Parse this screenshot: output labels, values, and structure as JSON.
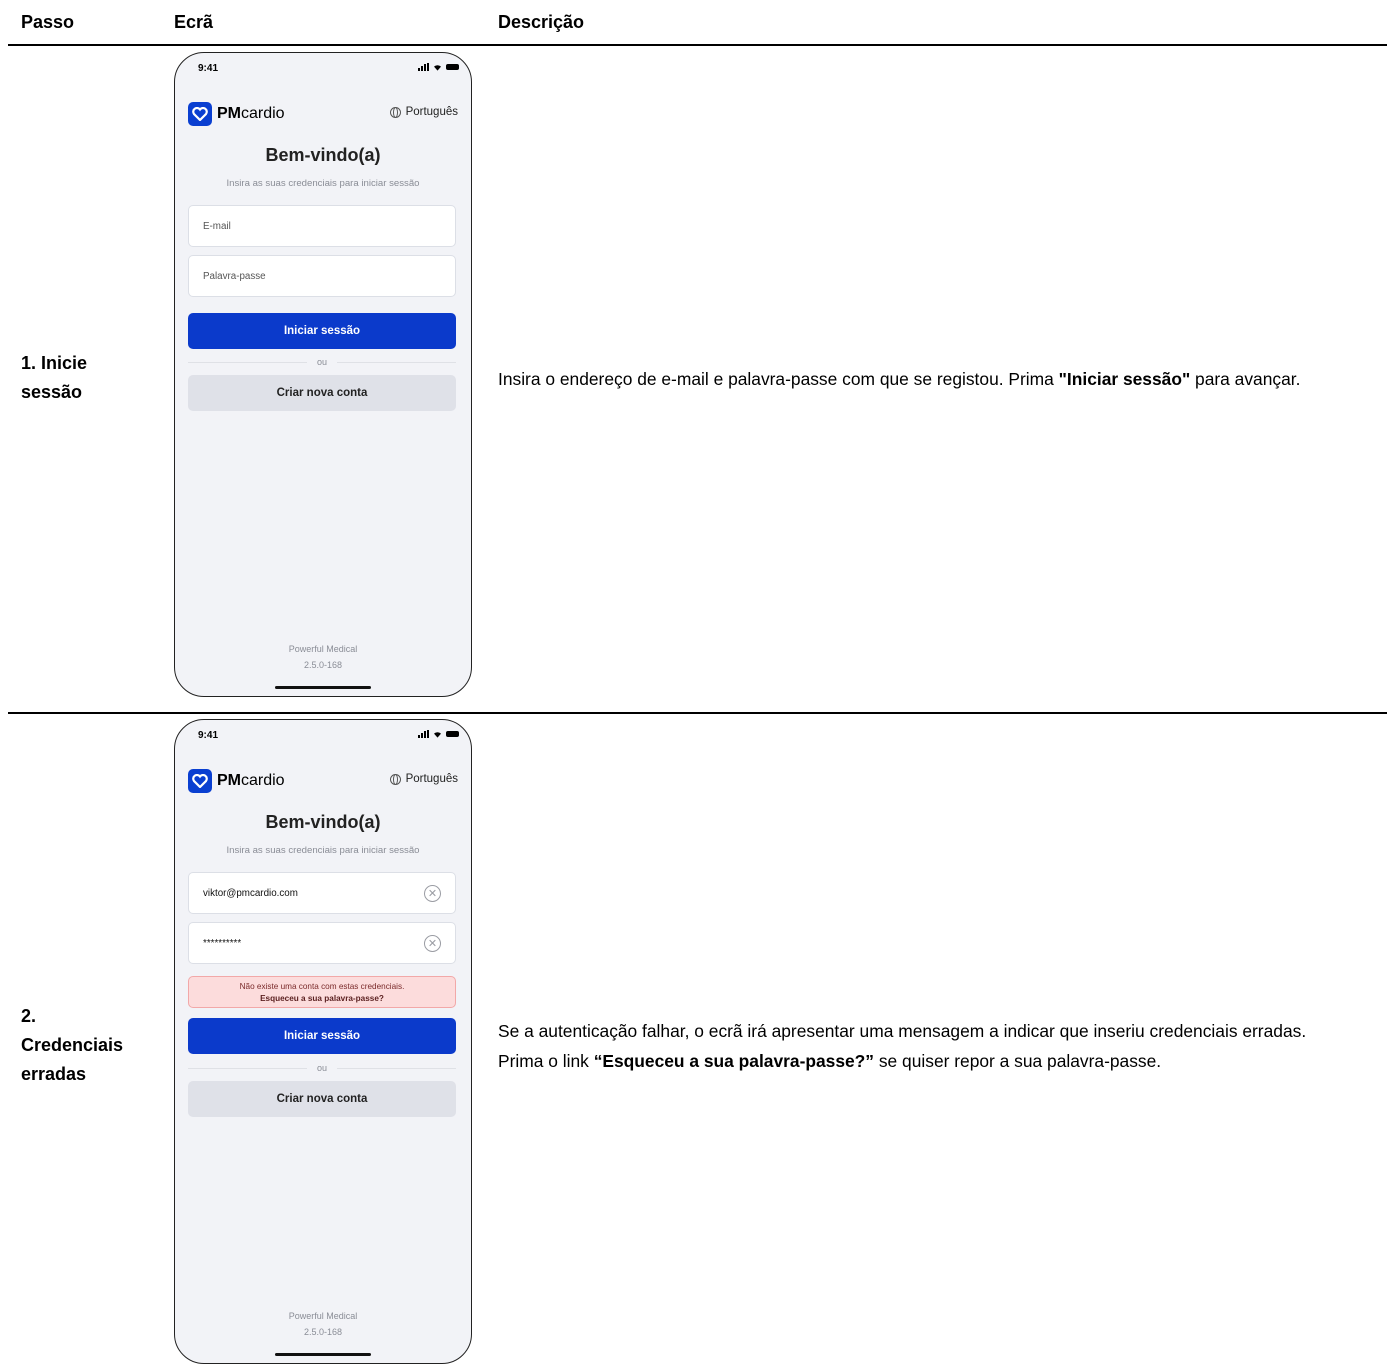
{
  "table": {
    "headers": {
      "step": "Passo",
      "screen": "Ecrã",
      "description": "Descrição"
    }
  },
  "rows": [
    {
      "step_lines": [
        "1. Inicie",
        "sessão"
      ],
      "description": {
        "pre": "Insira o endereço de e-mail e palavra-passe com que se registou. Prima ",
        "bold": "\"Iniciar sessão\"",
        "post": " para avançar."
      },
      "phone": {
        "time": "9:41",
        "brand_bold": "PM",
        "brand_rest": "cardio",
        "language": "Português",
        "title": "Bem-vindo(a)",
        "subtitle": "Insira as suas credenciais para iniciar sessão",
        "email_placeholder": "E-mail",
        "password_placeholder": "Palavra-passe",
        "login_button": "Iniciar sessão",
        "divider": "ou",
        "create_account_button": "Criar nova conta",
        "footer_brand": "Powerful Medical",
        "footer_version": "2.5.0-168"
      }
    },
    {
      "step_lines": [
        "2.",
        "Credenciais",
        "erradas"
      ],
      "description": {
        "line1": "Se a autenticação falhar, o ecrã irá apresentar uma mensagem a indicar que inseriu credenciais erradas.",
        "pre": "Prima o link ",
        "bold": "“Esqueceu a sua palavra-passe?”",
        "post": " se quiser repor a sua palavra-passe."
      },
      "phone": {
        "time": "9:41",
        "brand_bold": "PM",
        "brand_rest": "cardio",
        "language": "Português",
        "title": "Bem-vindo(a)",
        "subtitle": "Insira as suas credenciais para iniciar sessão",
        "email_value": "viktor@pmcardio.com",
        "password_value": "**********",
        "error_message": "Não existe uma conta com estas credenciais.",
        "error_link": "Esqueceu a sua palavra-passe?",
        "login_button": "Iniciar sessão",
        "divider": "ou",
        "create_account_button": "Criar nova conta",
        "footer_brand": "Powerful Medical",
        "footer_version": "2.5.0-168"
      }
    }
  ],
  "colors": {
    "primary": "#0b3acb",
    "error_bg": "#fcdcdc",
    "phone_bg": "#f2f3f7"
  }
}
